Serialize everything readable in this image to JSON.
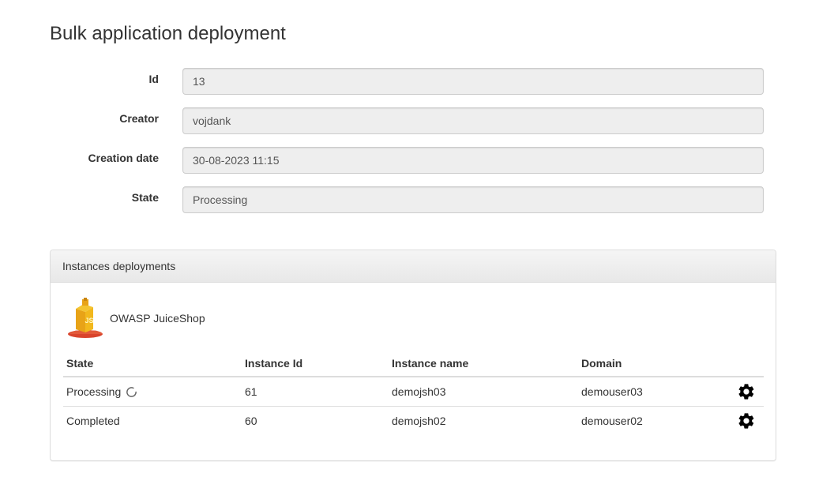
{
  "page": {
    "title": "Bulk application deployment"
  },
  "form": {
    "fields": [
      {
        "label": "Id",
        "value": "13"
      },
      {
        "label": "Creator",
        "value": "vojdank"
      },
      {
        "label": "Creation date",
        "value": "30-08-2023 11:15"
      },
      {
        "label": "State",
        "value": "Processing"
      }
    ]
  },
  "panel": {
    "heading": "Instances deployments",
    "application": {
      "name": "OWASP JuiceShop",
      "icon": "juiceshop-logo-icon"
    },
    "table": {
      "headers": [
        "State",
        "Instance Id",
        "Instance name",
        "Domain"
      ],
      "rows": [
        {
          "state": "Processing",
          "state_icon": "spinner-icon",
          "instance_id": "61",
          "instance_name": "demojsh03",
          "domain": "demouser03",
          "action_icon": "gear-icon"
        },
        {
          "state": "Completed",
          "instance_id": "60",
          "instance_name": "demojsh02",
          "domain": "demouser02",
          "action_icon": "gear-icon"
        }
      ]
    }
  }
}
